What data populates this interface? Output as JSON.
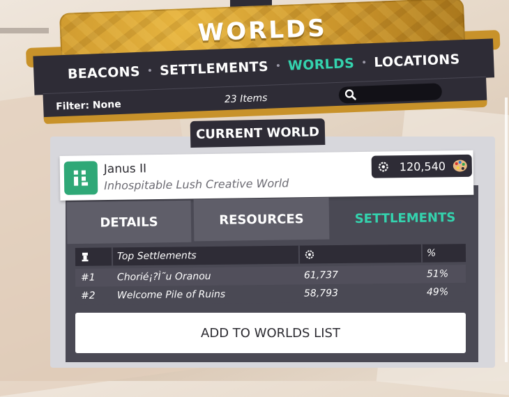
{
  "header": {
    "title": "WORLDS",
    "tabs": [
      {
        "label": "BEACONS",
        "active": false
      },
      {
        "label": "SETTLEMENTS",
        "active": false
      },
      {
        "label": "WORLDS",
        "active": true
      },
      {
        "label": "LOCATIONS",
        "active": false
      }
    ],
    "filter_label": "Filter: None",
    "items_count": "23 Items",
    "search": {
      "value": "",
      "icon": "search-icon"
    }
  },
  "current_world_label": "CURRENT WORLD",
  "world": {
    "name": "Janus II",
    "type": "Inhospitable Lush Creative World",
    "icon": "world-icon",
    "prestige": "120,540",
    "prestige_icon": "gear-icon",
    "creative_icon": "palette-icon"
  },
  "detail_tabs": [
    {
      "label": "DETAILS",
      "active": false
    },
    {
      "label": "RESOURCES",
      "active": false
    },
    {
      "label": "SETTLEMENTS",
      "active": true
    }
  ],
  "settlements_table": {
    "headers": {
      "rank_icon": "tower-icon",
      "name": "Top Settlements",
      "value_icon": "gear-icon",
      "percent": "%"
    },
    "rows": [
      {
        "rank": "#1",
        "name": "Chorié¡?Ì˜u Oranou",
        "value": "61,737",
        "percent": "51%"
      },
      {
        "rank": "#2",
        "name": "Welcome Pile of Ruins",
        "value": "58,793",
        "percent": "49%"
      }
    ]
  },
  "add_button": "ADD TO WORLDS LIST",
  "colors": {
    "accent": "#34d3ae",
    "gold": "#c8922a",
    "dark": "#2e2c36",
    "panel": "#4a4954"
  }
}
